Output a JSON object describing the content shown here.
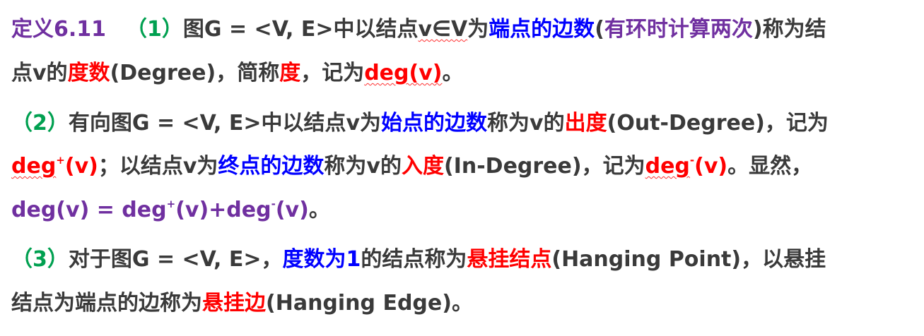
{
  "line1": {
    "definition_label": "定义6.11",
    "item_number": "（1）",
    "text_a": "图G = <V, E>中以结点",
    "v_in_V": "v∈V",
    "text_b": "为",
    "endpoint_edges": "端点的边数",
    "paren_open": "(",
    "loop_note": "有环时计算两次",
    "paren_close": ")",
    "text_c": "称为结"
  },
  "line2": {
    "text_a": "点v的",
    "degree_cn": "度数",
    "degree_en": "(Degree)，简称",
    "degree_short": "度",
    "text_b": "，记为",
    "deg_v": "deg(v)",
    "end": "。"
  },
  "line3": {
    "item_number": "（2）",
    "text_a": "有向图G = <V, E>中以结点v为",
    "start_edges": "始点的边数",
    "text_b": "称为v的",
    "out_degree_cn": "出度",
    "out_degree_en": "(Out-Degree)，记为"
  },
  "line4": {
    "deg": "deg",
    "sup_plus": "+",
    "v": "(v)",
    "text_a": "；以结点v为",
    "end_edges": "终点的边数",
    "text_b": "称为v的",
    "in_degree_cn": "入度",
    "in_degree_en": "(In-Degree)，记为",
    "deg2": "deg",
    "sup_minus": "-",
    "v2": "(v)",
    "text_c": "。显然，"
  },
  "line5": {
    "formula_a": "deg(v) = deg",
    "sup_plus": "+",
    "formula_b": "(v)+deg",
    "sup_minus": "-",
    "formula_c": "(v)",
    "end": "。"
  },
  "line6": {
    "item_number": "（3）",
    "text_a": "对于图G = <V, E>，",
    "degree_one": "度数为1",
    "text_b": "的结点称为",
    "hanging_point_cn": "悬挂结点",
    "hanging_point_en": "(Hanging Point)，以悬挂"
  },
  "line7": {
    "text_a": "结点为端点的边称为",
    "hanging_edge_cn": "悬挂边",
    "hanging_edge_en": "(Hanging Edge)。"
  },
  "colors": {
    "purple": "#7030a0",
    "green": "#00a050",
    "blue": "#0000ff",
    "red": "#ff0000",
    "text": "#3a3a3a"
  }
}
